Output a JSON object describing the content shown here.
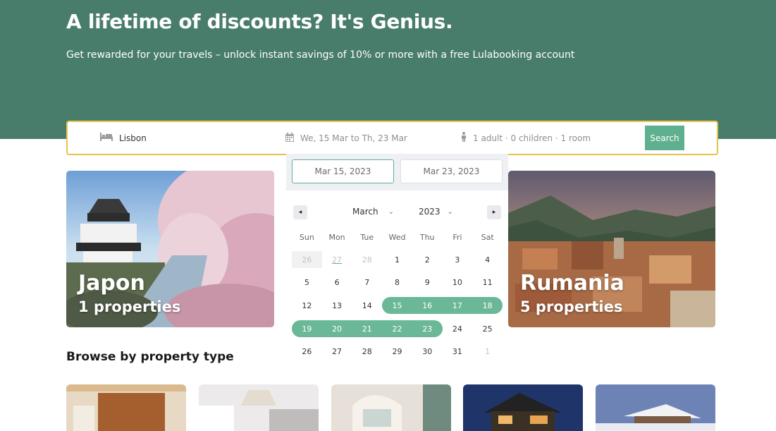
{
  "hero": {
    "title": "A lifetime of discounts? It's Genius.",
    "subtitle": "Get rewarded for your travels – unlock instant savings of 10% or more with a free Lulabooking account"
  },
  "search": {
    "destination": "Lisbon",
    "dates": "We, 15 Mar to Th, 23 Mar",
    "guests": "1 adult · 0 children · 1 room",
    "button": "Search",
    "icons": {
      "destination": "bed-icon",
      "dates": "calendar-icon",
      "guests": "person-icon"
    }
  },
  "datepicker": {
    "start_date": "Mar 15, 2023",
    "end_date": "Mar 23, 2023",
    "month": "March",
    "year": "2023",
    "prev": "◂",
    "next": "▸",
    "weekdays": [
      "Sun",
      "Mon",
      "Tue",
      "Wed",
      "Thu",
      "Fri",
      "Sat"
    ],
    "weeks": [
      [
        "26",
        "27",
        "28",
        "1",
        "2",
        "3",
        "4"
      ],
      [
        "5",
        "6",
        "7",
        "8",
        "9",
        "10",
        "11"
      ],
      [
        "12",
        "13",
        "14",
        "15",
        "16",
        "17",
        "18"
      ],
      [
        "19",
        "20",
        "21",
        "22",
        "23",
        "24",
        "25"
      ],
      [
        "26",
        "27",
        "28",
        "29",
        "30",
        "31",
        "1"
      ]
    ],
    "range_start": "15",
    "range_end": "23",
    "accent": "#6ab897"
  },
  "destinations": [
    {
      "name": "Japon",
      "count": "1 properties"
    },
    {
      "name": "Rumania",
      "count": "5 properties"
    }
  ],
  "browse": {
    "title": "Browse by property type"
  },
  "colors": {
    "hero": "#487d6b",
    "accent": "#5fb08f",
    "search_border": "#e6c34a"
  }
}
